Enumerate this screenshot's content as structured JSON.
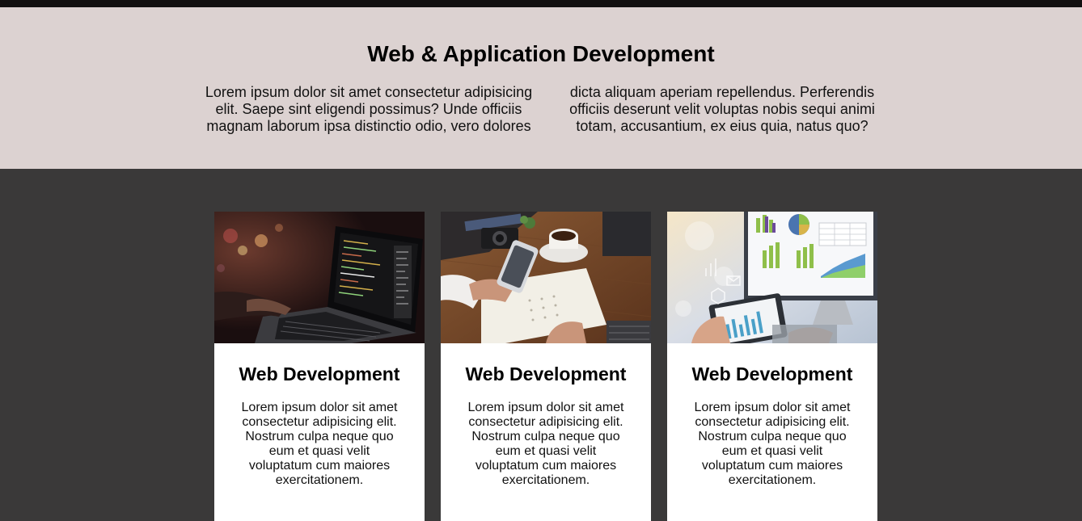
{
  "intro": {
    "title": "Web & Application Development",
    "text_col1": "Lorem ipsum dolor sit amet consectetur adipisicing elit. Saepe sint eligendi possimus? Unde officiis magnam laborum ipsa distinctio odio, vero dolores",
    "text_col2": "dicta aliquam aperiam repellendus. Perferendis officiis deserunt velit voluptas nobis sequi animi totam, accusantium, ex eius quia, natus quo?"
  },
  "cards": [
    {
      "image": "laptop-code-photo",
      "title": "Web Development",
      "text": "Lorem ipsum dolor sit amet consectetur adipisicing elit. Nostrum culpa neque quo eum et quasi velit voluptatum cum maiores exercitationem."
    },
    {
      "image": "phone-desk-photo",
      "title": "Web Development",
      "text": "Lorem ipsum dolor sit amet consectetur adipisicing elit. Nostrum culpa neque quo eum et quasi velit voluptatum cum maiores exercitationem."
    },
    {
      "image": "analytics-dashboard-photo",
      "title": "Web Development",
      "text": "Lorem ipsum dolor sit amet consectetur adipisicing elit. Nostrum culpa neque quo eum et quasi velit voluptatum cum maiores exercitationem."
    }
  ],
  "colors": {
    "top_bar": "#121010",
    "intro_bg": "#dcd2d1",
    "services_bg": "#3a3939",
    "card_bg": "#ffffff"
  }
}
